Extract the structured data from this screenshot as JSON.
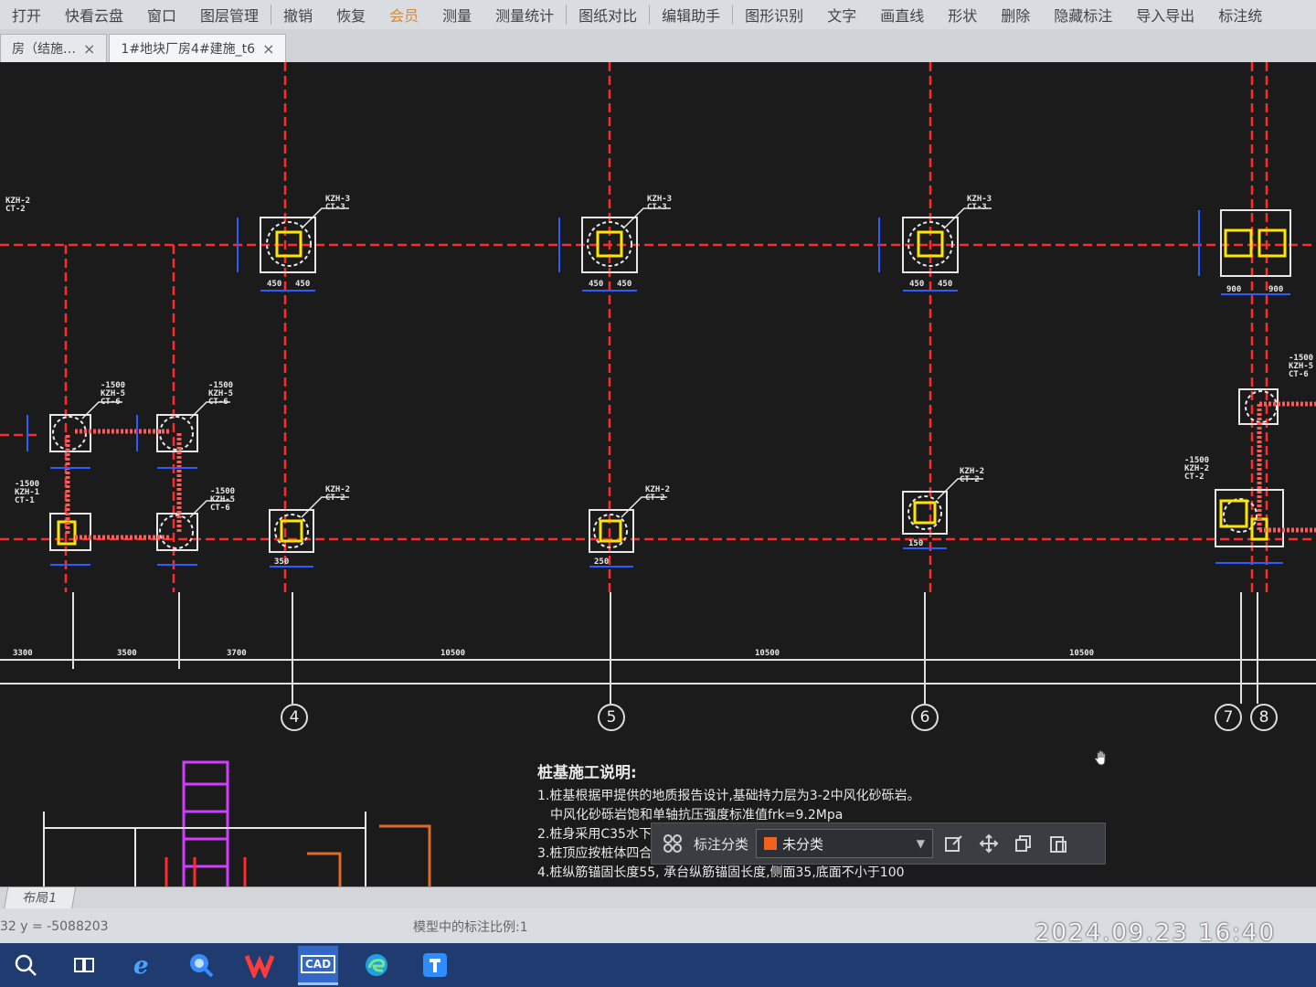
{
  "toolbar": {
    "items": [
      "打开",
      "快看云盘",
      "窗口",
      "图层管理",
      "撤销",
      "恢复",
      "会员",
      "测量",
      "测量统计",
      "图纸对比",
      "编辑助手",
      "图形识别",
      "文字",
      "画直线",
      "形状",
      "删除",
      "隐藏标注",
      "导入导出",
      "标注统"
    ]
  },
  "tabs": [
    {
      "label": "房（结施…",
      "close": "×"
    },
    {
      "label": "1#地块厂房4#建施_t6",
      "close": "×"
    }
  ],
  "drawing": {
    "axis_labels": [
      "4",
      "5",
      "6",
      "7",
      "8"
    ],
    "pile_tags": {
      "kzh3": "KZH-3",
      "ct3": "CT-3",
      "kzh2": "KZH-2",
      "ct2": "CT-2",
      "kzh5": "KZH-5",
      "ct6": "CT-6",
      "kzh1": "KZH-1",
      "ct1": "CT-1",
      "elev": "-1500"
    },
    "dims": {
      "d450": "450",
      "d900": "900",
      "d3300": "3300",
      "d3500": "3500",
      "d3700": "3700",
      "d10500": "10500",
      "d10500b": "10500",
      "d10500c": "10500",
      "d350": "350",
      "d250": "250",
      "d150": "150"
    },
    "notes": {
      "title": "桩基施工说明:",
      "line1": "1.桩基根据甲提供的地质报告设计,基础持力层为3-2中风化砂砾岩。",
      "line1b": "中风化砂砾岩饱和单轴抗压强度标准值frk=9.2Mpa",
      "line2": "2.桩身采用C35水下砼(无",
      "line3": "3.桩顶应按桩体四合并剔除,",
      "line4": "4.桩纵筋锚固长度55, 承台纵筋锚固长度,侧面35,底面不小于100"
    }
  },
  "float_bar": {
    "label": "标注分类",
    "selected": "未分类",
    "swatch_color": "#f0631c"
  },
  "layout_tab": "布局1",
  "status": {
    "coords": "32  y = -5088203",
    "scale": "模型中的标注比例:1"
  },
  "timestamp": "2024.09.23  16:40",
  "taskbar": {
    "icons": [
      "search-icon",
      "task-view-icon",
      "ie-icon",
      "search-app-icon",
      "wps-icon",
      "cad-icon",
      "edge-icon",
      "tencent-icon"
    ],
    "cad_text": "CAD"
  }
}
